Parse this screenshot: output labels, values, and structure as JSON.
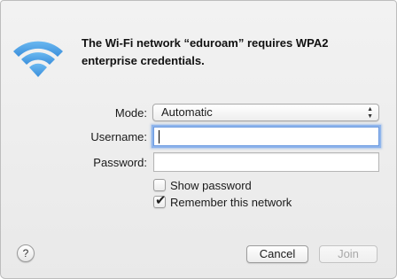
{
  "dialog": {
    "heading": "The Wi-Fi network “eduroam” requires WPA2 enterprise credentials.",
    "network_name": "eduroam",
    "icon": "wifi-icon"
  },
  "form": {
    "mode": {
      "label": "Mode:",
      "selected": "Automatic",
      "arrows": "▲\n▼"
    },
    "username": {
      "label": "Username:",
      "value": ""
    },
    "password": {
      "label": "Password:",
      "value": ""
    },
    "show_password": {
      "label": "Show password",
      "checked": false
    },
    "remember_network": {
      "label": "Remember this network",
      "checked": true,
      "mark": "✔"
    }
  },
  "footer": {
    "help": "?",
    "cancel_label": "Cancel",
    "join_label": "Join",
    "join_enabled": false
  },
  "colors": {
    "wifi_blue": "#4a9ee6",
    "focus_ring": "#8fb5ec",
    "disabled_text": "#a8a8a8"
  }
}
